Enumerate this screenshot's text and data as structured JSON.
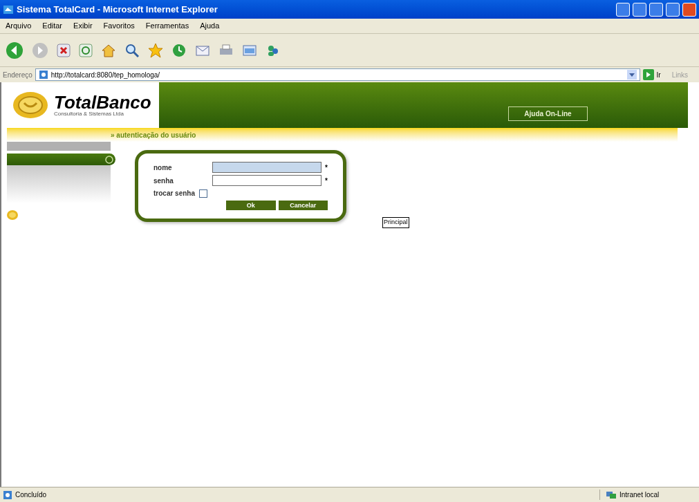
{
  "window": {
    "title": "Sistema TotalCard - Microsoft Internet Explorer"
  },
  "menu": [
    "Arquivo",
    "Editar",
    "Exibir",
    "Favoritos",
    "Ferramentas",
    "Ajuda"
  ],
  "address_bar": {
    "label": "Endereço",
    "value": "http://totalcard:8080/tep_homologa/",
    "go": "Ir",
    "links": "Links"
  },
  "header": {
    "brand": "TotalBanco",
    "tagline": "Consultoria & Sistemas Ltda",
    "help_button": "Ajuda On-Line"
  },
  "breadcrumb": "» autenticação do usuário",
  "login": {
    "fields": [
      {
        "label": "nome",
        "required": "*",
        "focused": true
      },
      {
        "label": "senha",
        "required": "*",
        "focused": false
      }
    ],
    "change_password": {
      "label": "trocar senha",
      "checked": false
    },
    "buttons": [
      "Ok",
      "Cancelar"
    ]
  },
  "principal_button": "Principal",
  "status_bar": {
    "text": "Concluído",
    "zone": "Intranet local"
  }
}
